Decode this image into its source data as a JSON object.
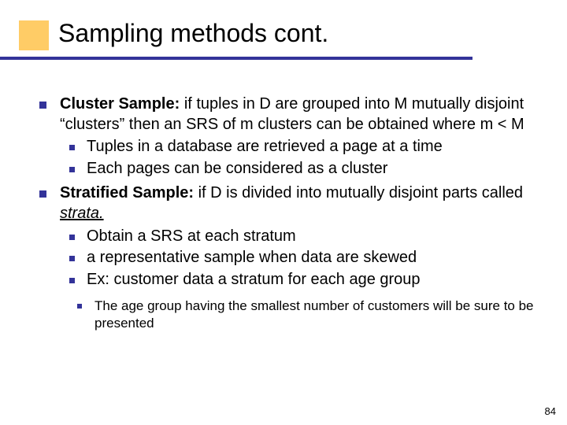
{
  "title": "Sampling methods cont.",
  "bullets": {
    "cluster": {
      "label": "Cluster Sample:",
      "text": " if tuples in D are grouped into M mutually disjoint “clusters” then an SRS of m clusters can be obtained where m < M",
      "sub": {
        "a": "Tuples in a database are retrieved a page at a time",
        "b": "Each pages can be considered as a cluster"
      }
    },
    "stratified": {
      "label": "Stratified Sample:",
      "text_a": " if D is divided into mutually disjoint parts called ",
      "strata": "strata.",
      "sub": {
        "a": "Obtain a SRS at each stratum",
        "b": "a representative sample when data are skewed",
        "c": "Ex: customer data a stratum for each age group",
        "note": "The age group having the smallest number of customers will be sure to be presented"
      }
    }
  },
  "page_number": "84"
}
